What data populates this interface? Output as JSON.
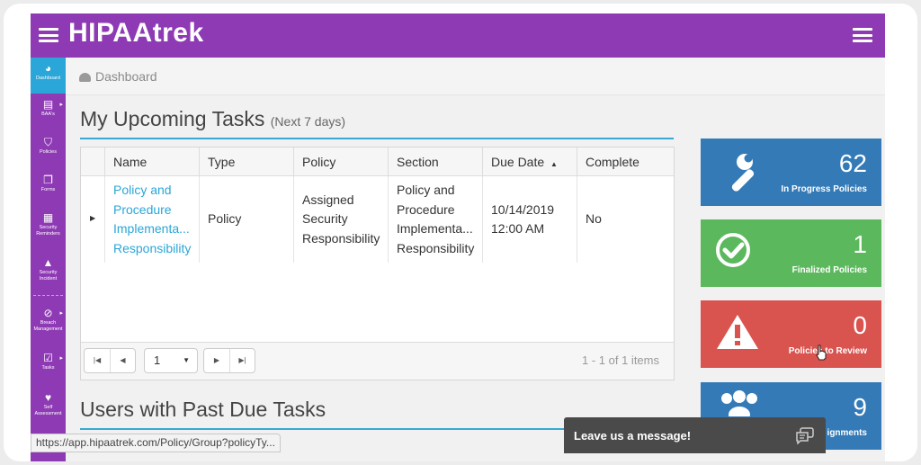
{
  "app": {
    "logo": "HIPAAtrek"
  },
  "sidebar": {
    "items": [
      {
        "label": "Dashboard",
        "icon": "dashboard-icon"
      },
      {
        "label": "BAA's",
        "icon": "document-icon"
      },
      {
        "label": "Policies",
        "icon": "shield-icon"
      },
      {
        "label": "Forms",
        "icon": "forms-icon"
      },
      {
        "label": "Security Reminders",
        "icon": "calendar-icon"
      },
      {
        "label": "Security Incident",
        "icon": "warning-icon"
      },
      {
        "label": "Breach Management",
        "icon": "breach-icon"
      },
      {
        "label": "Tasks",
        "icon": "tasks-icon"
      },
      {
        "label": "Self Assessment",
        "icon": "heartbeat-icon"
      }
    ]
  },
  "breadcrumb": {
    "label": "Dashboard"
  },
  "upcoming": {
    "title": "My Upcoming Tasks",
    "subtitle": "(Next 7 days)",
    "columns": [
      "Name",
      "Type",
      "Policy",
      "Section",
      "Due Date",
      "Complete"
    ],
    "sort_indicator": "▲",
    "row": {
      "name_lines": [
        "Policy and",
        "Procedure",
        "Implementa...",
        "Responsibility"
      ],
      "type": "Policy",
      "policy_lines": [
        "Assigned",
        "Security",
        "Responsibility"
      ],
      "section_lines": [
        "Policy and",
        "Procedure",
        "Implementa...",
        "Responsibility"
      ],
      "due_lines": [
        "10/14/2019",
        "12:00 AM"
      ],
      "complete": "No"
    },
    "pager": {
      "page": "1",
      "info": "1 - 1 of 1 items"
    }
  },
  "past_due": {
    "title": "Users with Past Due Tasks"
  },
  "cards": [
    {
      "value": "62",
      "label": "In Progress Policies",
      "color": "#337ab7",
      "icon": "wrench-icon"
    },
    {
      "value": "1",
      "label": "Finalized Policies",
      "color": "#5cb85c",
      "icon": "check-circle-icon"
    },
    {
      "value": "0",
      "label": "Policies to Review",
      "color": "#d9534f",
      "icon": "warning-icon"
    },
    {
      "value": "9",
      "label": "ignments",
      "color": "#337ab7",
      "icon": "users-icon"
    }
  ],
  "statusbar": {
    "url": "https://app.hipaatrek.com/Policy/Group?policyTy..."
  },
  "chat": {
    "label": "Leave us a message!"
  }
}
